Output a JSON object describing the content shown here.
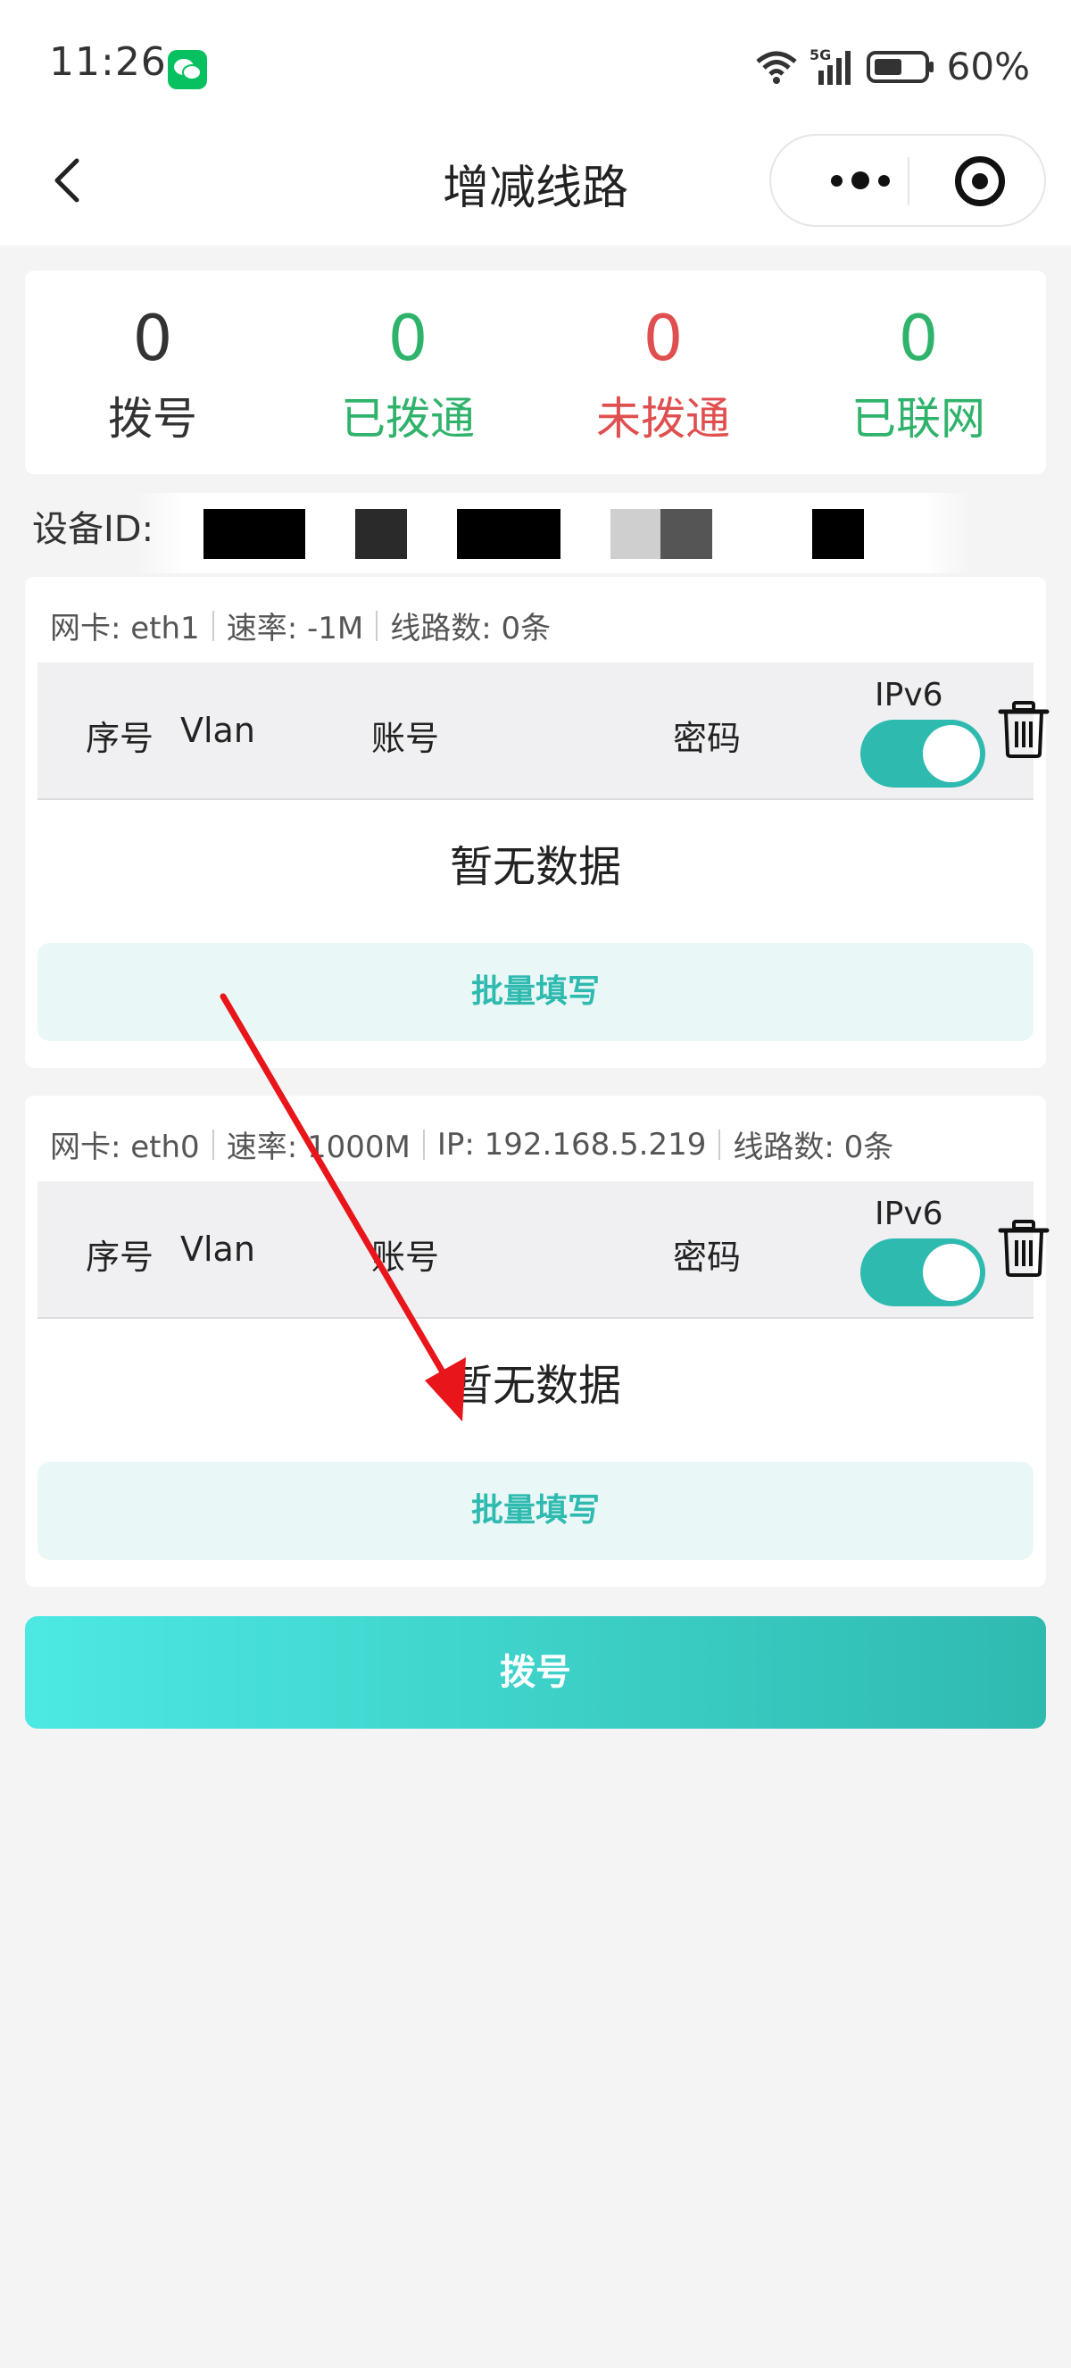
{
  "status_bar": {
    "time": "11:26",
    "battery": "60%"
  },
  "nav": {
    "title": "增减线路"
  },
  "stats": [
    {
      "value": "0",
      "label": "拨号"
    },
    {
      "value": "0",
      "label": "已拨通"
    },
    {
      "value": "0",
      "label": "未拨通"
    },
    {
      "value": "0",
      "label": "已联网"
    }
  ],
  "device": {
    "label": "设备ID:"
  },
  "cards": [
    {
      "nic": "网卡: eth1",
      "rate": "速率: -1M",
      "lines": "线路数: 0条",
      "columns": {
        "index": "序号",
        "vlan": "Vlan",
        "account": "账号",
        "password": "密码",
        "ipv6": "IPv6"
      },
      "empty": "暂无数据",
      "batch_button": "批量填写"
    },
    {
      "nic": "网卡: eth0",
      "rate": "速率: 1000M",
      "ip": "IP: 192.168.5.219",
      "lines": "线路数: 0条",
      "columns": {
        "index": "序号",
        "vlan": "Vlan",
        "account": "账号",
        "password": "密码",
        "ipv6": "IPv6"
      },
      "empty": "暂无数据",
      "batch_button": "批量填写"
    }
  ],
  "dial_button": "拨号",
  "colors": {
    "accent": "#2fbab0",
    "success": "#2fb36b",
    "danger": "#e04f4f",
    "annotation_arrow": "#e8151b"
  },
  "icons": [
    "back-arrow-icon",
    "more-dots-icon",
    "close-target-icon",
    "trash-icon",
    "wechat-icon",
    "wifi-icon",
    "signal-icon",
    "battery-icon"
  ]
}
